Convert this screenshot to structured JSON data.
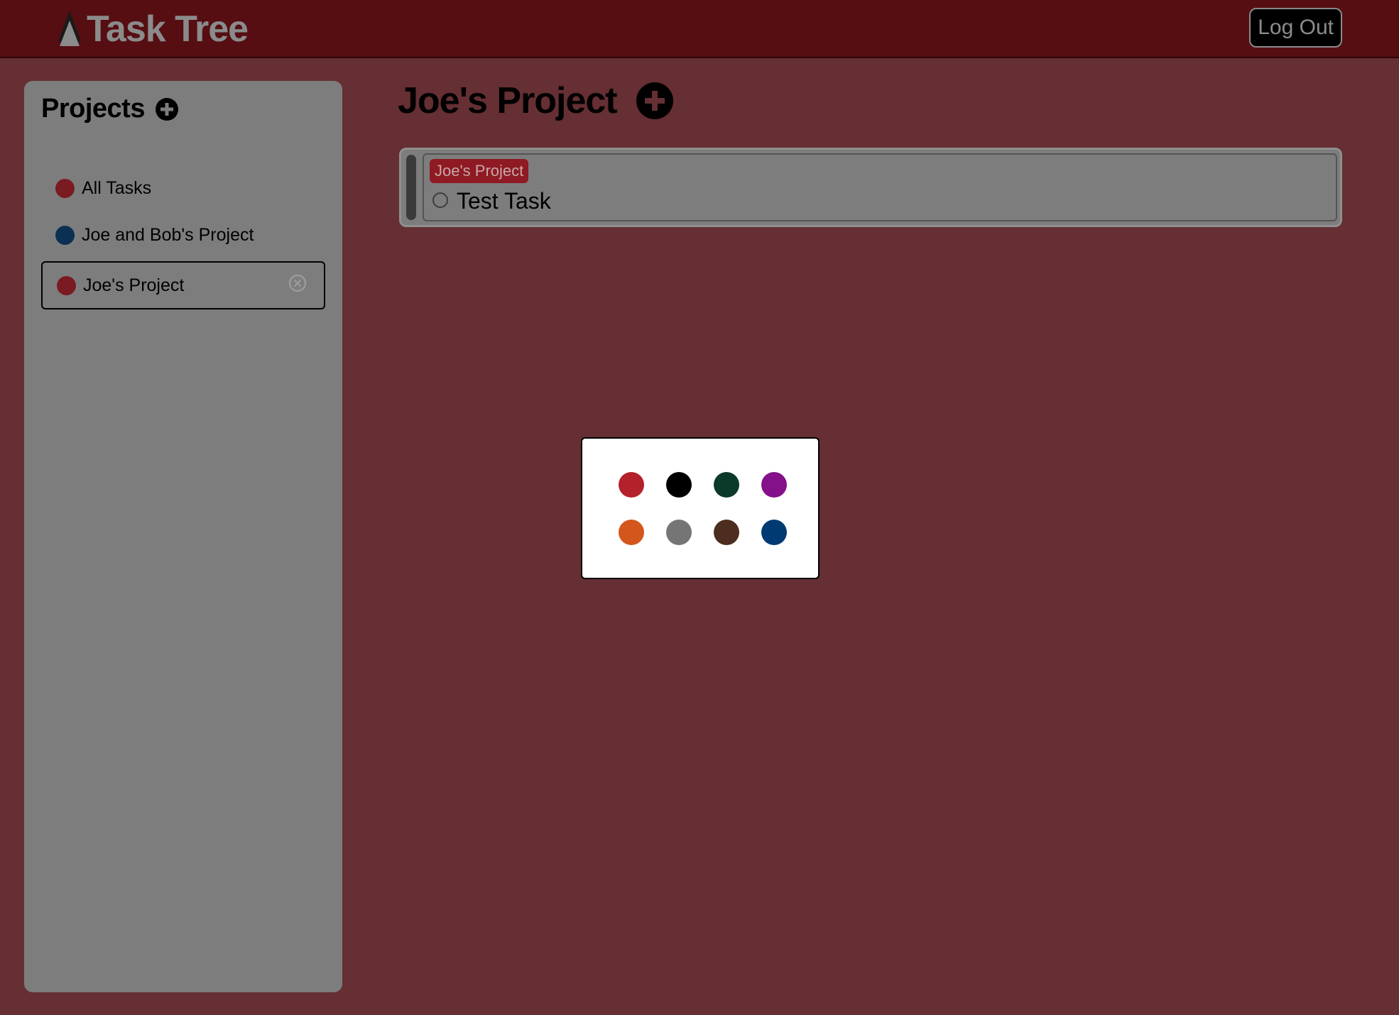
{
  "header": {
    "app_name": "Task Tree",
    "logout_label": "Log Out",
    "logo_icon": "tree-icon"
  },
  "sidebar": {
    "title": "Projects",
    "add_icon": "plus-circle-icon",
    "projects": [
      {
        "label": "All Tasks",
        "color": "#7a1a21",
        "selected": false
      },
      {
        "label": "Joe and Bob's Project",
        "color": "#0b3052",
        "selected": false
      },
      {
        "label": "Joe's Project",
        "color": "#7a1a21",
        "selected": true,
        "remove_icon": "close-circle-icon"
      }
    ]
  },
  "main": {
    "title": "Joe's Project",
    "add_icon": "plus-circle-icon",
    "tasks": [
      {
        "project_tag": "Joe's Project",
        "title": "Test Task",
        "completed": false
      }
    ]
  },
  "color_picker": {
    "colors": [
      "#b3212b",
      "#000000",
      "#0b3a2a",
      "#84108a",
      "#d4561c",
      "#757575",
      "#4d2d1f",
      "#003a72"
    ]
  }
}
